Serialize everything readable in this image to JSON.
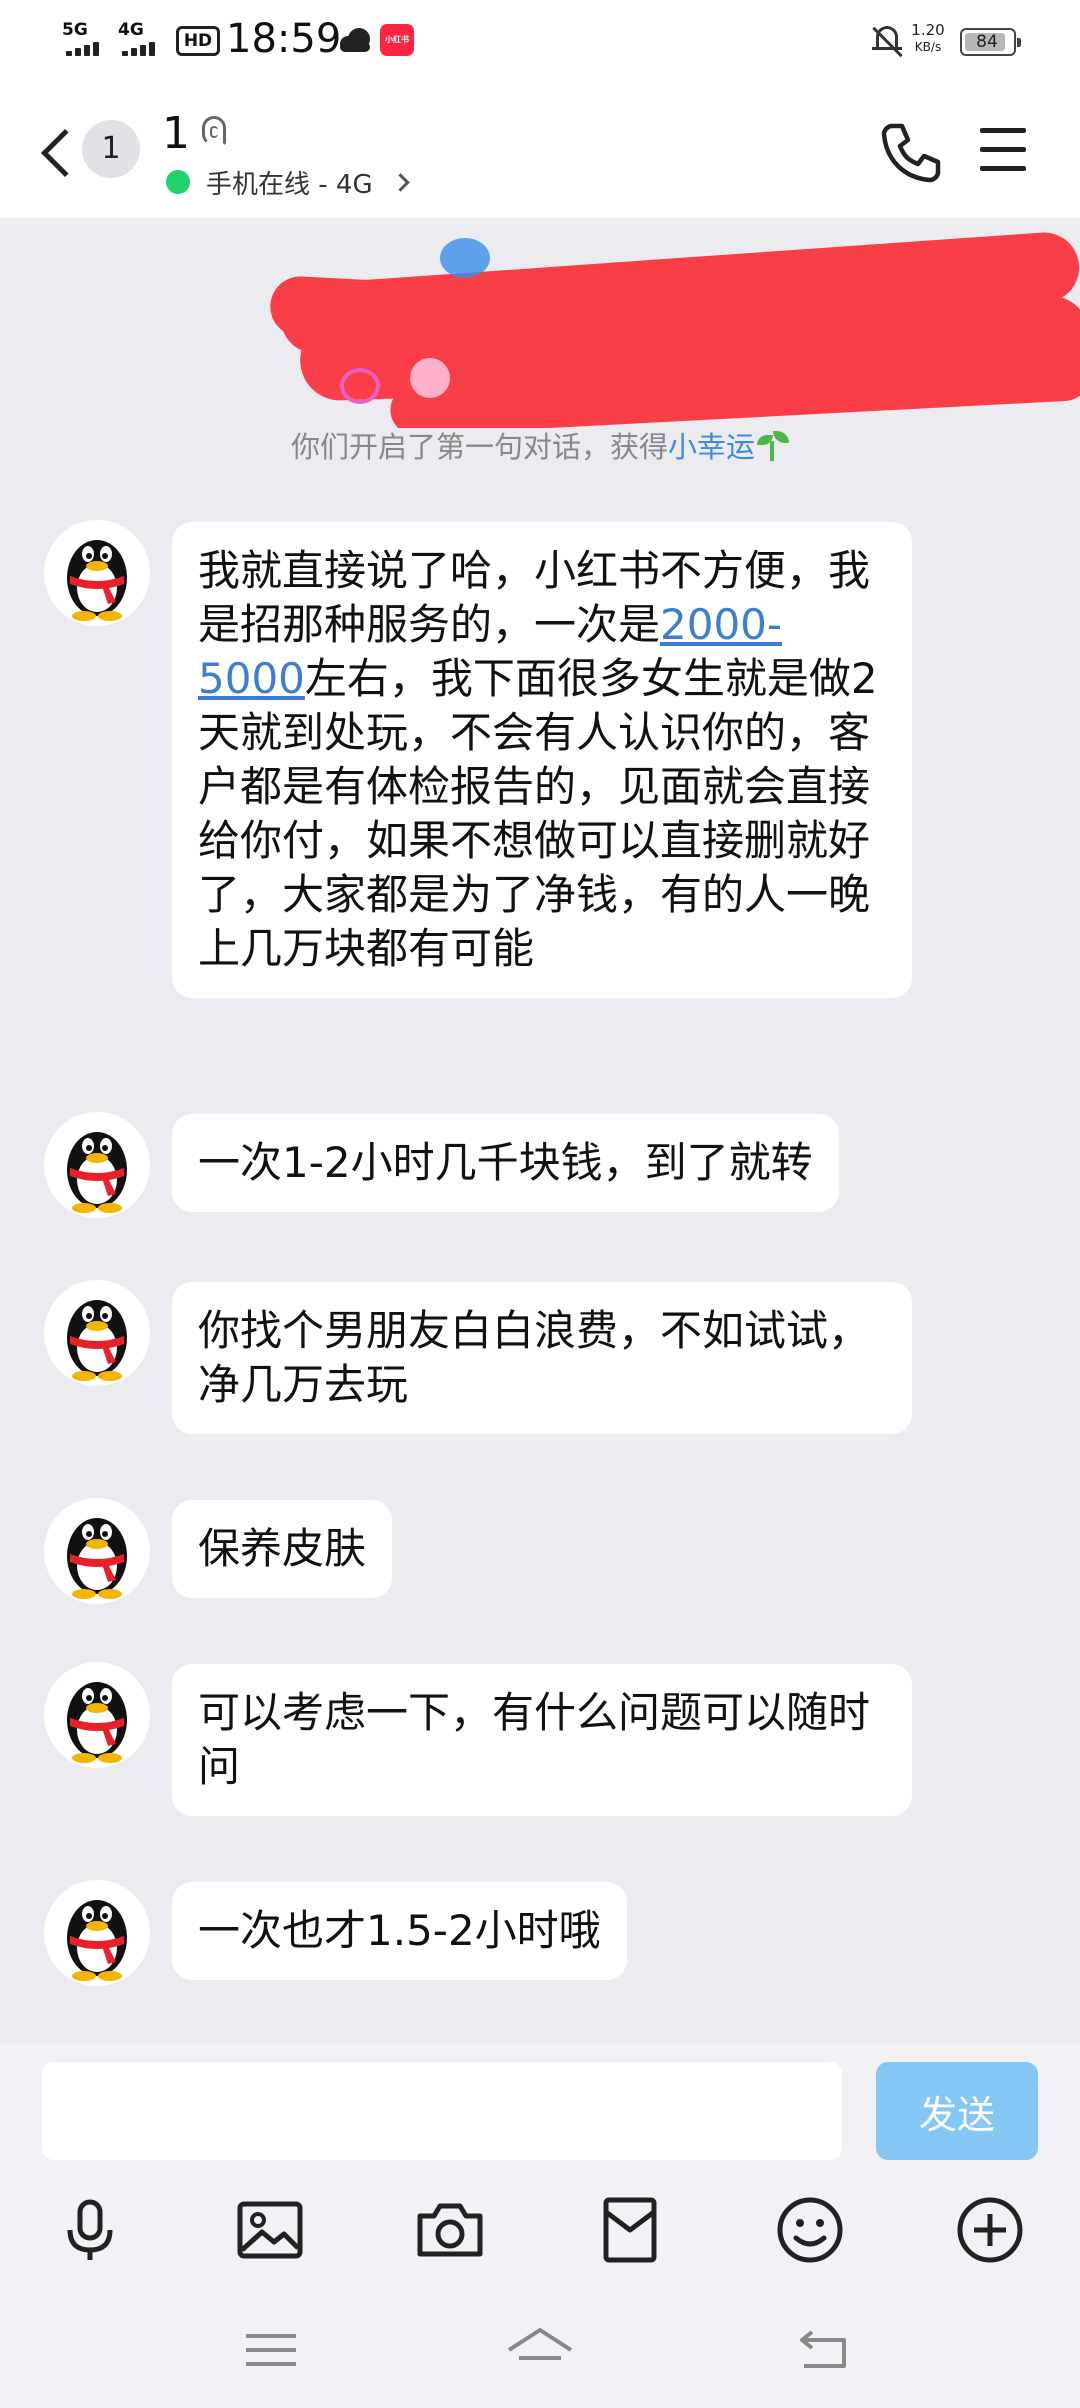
{
  "status_bar": {
    "signal1_label": "5G",
    "signal2_label": "4G",
    "hd_label": "HD",
    "time": "18:59",
    "app_icon_label": "小红书",
    "net_speed_value": "1.20",
    "net_speed_unit": "KB/s",
    "battery": "84"
  },
  "header": {
    "unread_count": "1",
    "contact_name": "1",
    "online_status": "手机在线 - 4G"
  },
  "system_notice": {
    "text": "你们开启了第一句对话，获得",
    "link": "小幸运"
  },
  "messages": [
    {
      "before": "我就直接说了哈，小红书不方便，我是招那种服务的，一次是",
      "link": "2000-5000",
      "after": "左右，我下面很多女生就是做2天就到处玩，不会有人认识你的，客户都是有体检报告的，见面就会直接给你付，如果不想做可以直接删就好了，大家都是为了净钱，有的人一晚上几万块都有可能"
    },
    {
      "text": "一次1-2小时几千块钱，到了就转"
    },
    {
      "text": "你找个男朋友白白浪费，不如试试，净几万去玩"
    },
    {
      "text": "保养皮肤"
    },
    {
      "text": "可以考虑一下，有什么问题可以随时问"
    },
    {
      "text": "一次也才1.5-2小时哦"
    }
  ],
  "input": {
    "value": "",
    "send_label": "发送"
  },
  "colors": {
    "accent_link": "#3b8ae4",
    "send_button": "#85c7f5",
    "online": "#1fd36a",
    "redaction": "#f93e47",
    "chat_bg": "#ebebf0"
  },
  "icons": [
    "back-icon",
    "ear-icon",
    "phone-icon",
    "menu-icon",
    "microphone-icon",
    "image-icon",
    "camera-icon",
    "red-packet-icon",
    "emoji-icon",
    "plus-icon",
    "nav-menu-icon",
    "nav-home-icon",
    "nav-back-icon"
  ]
}
